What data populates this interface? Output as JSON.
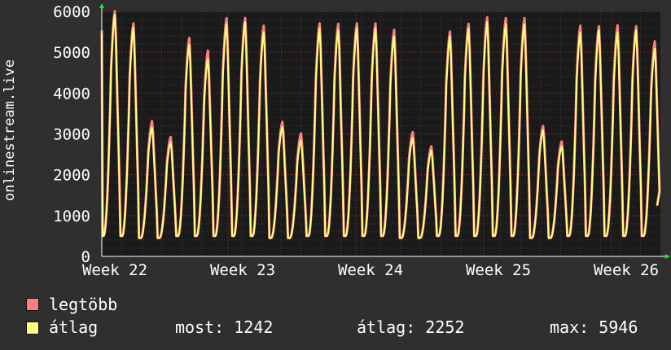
{
  "chart_data": {
    "type": "line",
    "ylabel": "onlinestream.live",
    "ylim": [
      0,
      6000
    ],
    "y_ticks": [
      "0",
      "1000",
      "2000",
      "3000",
      "4000",
      "5000",
      "6000"
    ],
    "x_ticks": [
      "Week 22",
      "Week 23",
      "Week 24",
      "Week 25",
      "Week 26"
    ],
    "grid": true,
    "days": 28,
    "series": [
      {
        "name": "legtöbb",
        "color": "#ff7f7f",
        "daily_peaks": [
          6020,
          5720,
          3320,
          2930,
          5360,
          5050,
          5850,
          5850,
          5660,
          3300,
          3020,
          5720,
          5710,
          5720,
          5720,
          5560,
          3050,
          2700,
          5520,
          5710,
          5870,
          5850,
          5850,
          3200,
          2820,
          5660,
          5650,
          5670,
          5650,
          5280
        ]
      },
      {
        "name": "átlag",
        "color": "#ffff7f",
        "daily_peaks": [
          5930,
          5620,
          3160,
          2800,
          5200,
          4850,
          5700,
          5750,
          5500,
          3180,
          2850,
          5600,
          5560,
          5600,
          5600,
          5400,
          2900,
          2600,
          5400,
          5600,
          5750,
          5700,
          5700,
          3100,
          2700,
          5500,
          5550,
          5500,
          5550,
          5100
        ]
      }
    ]
  },
  "legend": {
    "max_label": "legtöbb",
    "avg_label": "átlag",
    "most": "most: 1242",
    "atlag": "átlag: 2252",
    "max": "max: 5946"
  }
}
